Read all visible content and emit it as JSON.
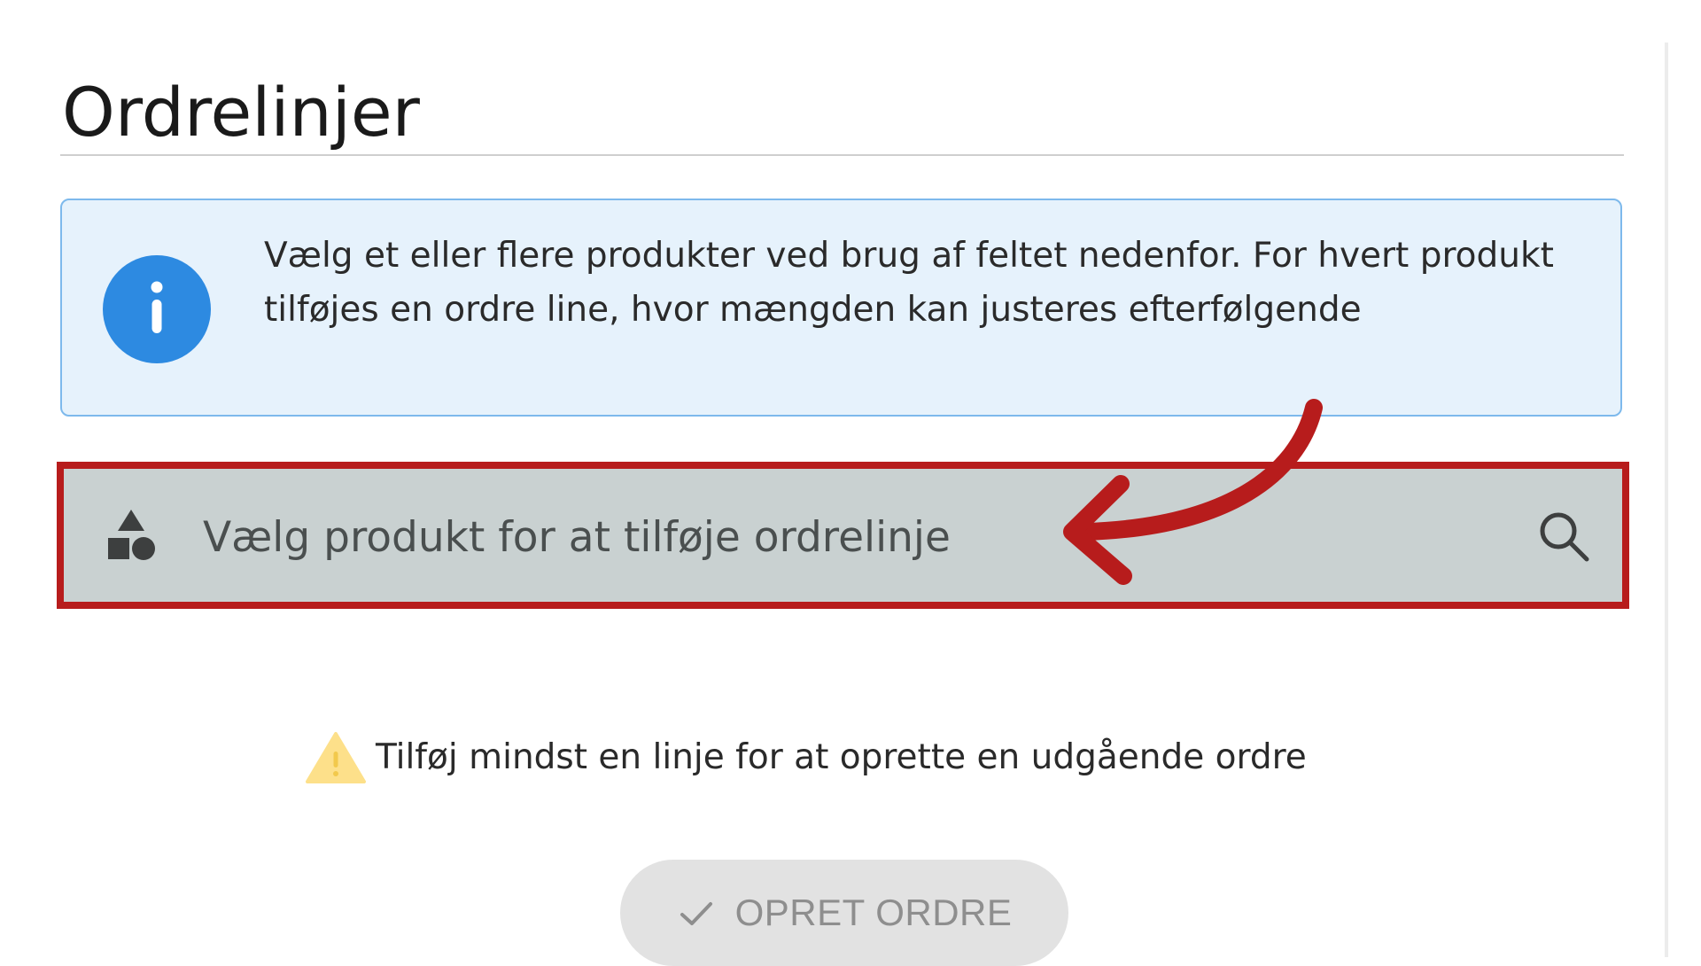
{
  "section": {
    "title": "Ordrelinjer"
  },
  "info": {
    "icon": "info-icon",
    "text": "Vælg et eller flere produkter ved brug af feltet nedenfor. For hvert produkt tilføjes en ordre line, hvor mængden kan justeres efterfølgende",
    "accent_color": "#2d8ae1"
  },
  "product_select": {
    "leading_icon": "shapes-icon",
    "placeholder": "Vælg produkt for at tilføje ordrelinje",
    "trailing_icon": "search-icon",
    "highlight_color": "#b71c1c"
  },
  "warning": {
    "icon": "warning-icon",
    "text": "Tilføj mindst en linje for at oprette en udgående ordre",
    "color": "#fde08a"
  },
  "actions": {
    "create_order_label": "OPRET ORDRE",
    "create_order_icon": "check-icon"
  }
}
